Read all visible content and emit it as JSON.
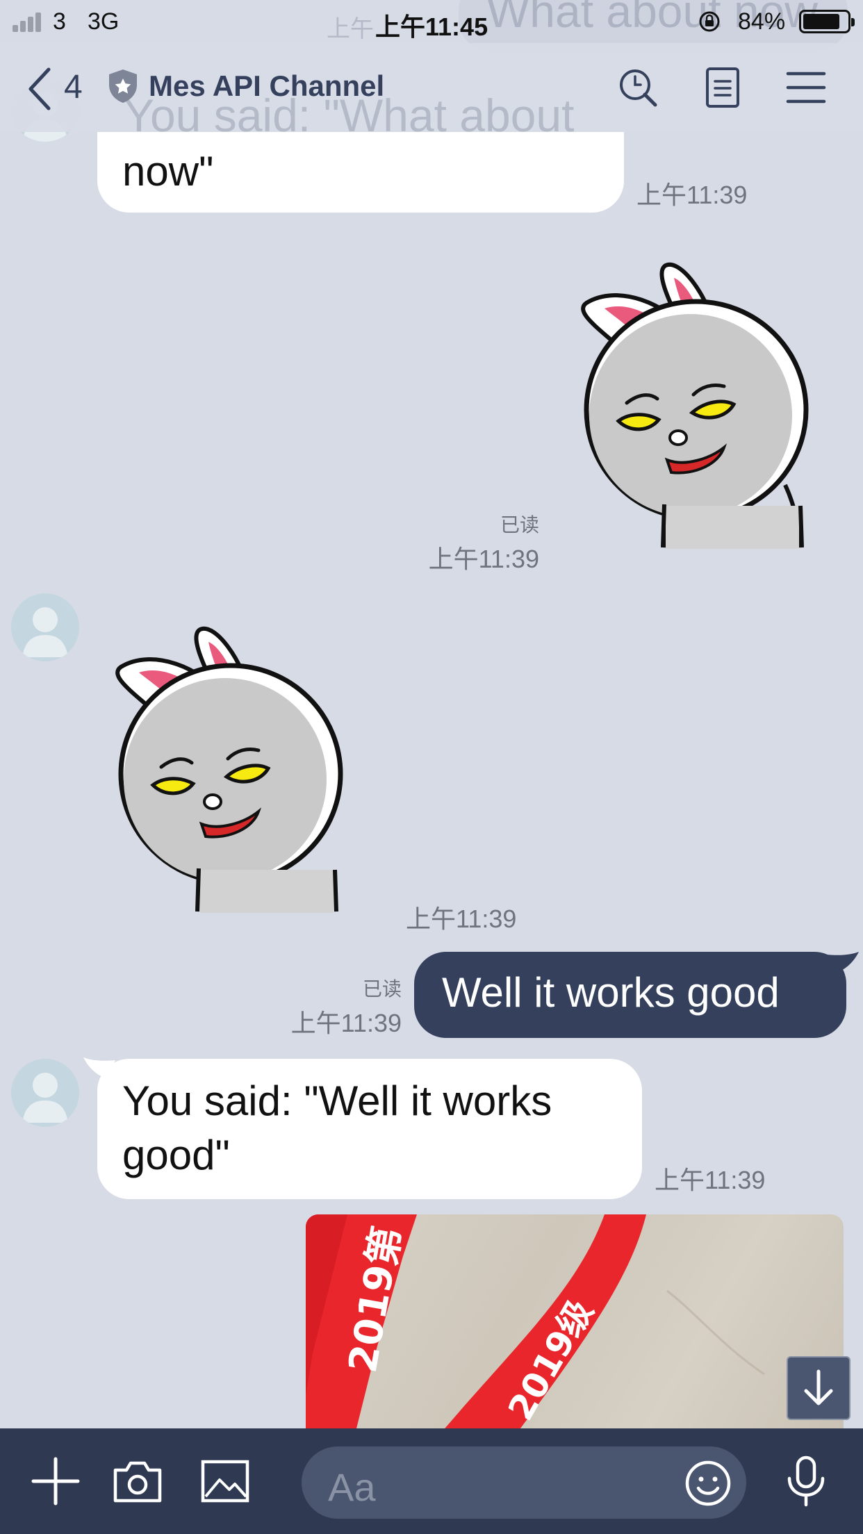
{
  "status_bar": {
    "carrier": "3",
    "network": "3G",
    "time": "上午11:45",
    "battery": "84%"
  },
  "header": {
    "back_count": "4",
    "channel_name": "Mes API Channel",
    "ghost_top": "What about now",
    "ghost_time": "上午",
    "ghost_bubble": "You said: \"What about"
  },
  "messages": [
    {
      "id": "m1",
      "side": "left",
      "type": "text",
      "text": "now\"",
      "time": "上午11:39"
    },
    {
      "id": "m2",
      "side": "right",
      "type": "sticker",
      "sticker": "bunny-smirk",
      "read": "已读",
      "time": "上午11:39"
    },
    {
      "id": "m3",
      "side": "left",
      "type": "sticker",
      "sticker": "bunny-smirk",
      "time": "上午11:39"
    },
    {
      "id": "m4",
      "side": "right",
      "type": "text",
      "text": "Well it works good",
      "read": "已读",
      "time": "上午11:39"
    },
    {
      "id": "m5",
      "side": "left",
      "type": "text",
      "text": "You said: \"Well it works good\"",
      "time": "上午11:39"
    },
    {
      "id": "m6",
      "side": "right",
      "type": "image",
      "caption": "lanyard photo",
      "lanyard_text": "2019第",
      "lanyard_text_2": "2019级"
    }
  ],
  "input_bar": {
    "placeholder": "Aa"
  },
  "icons": {
    "header": [
      "back-icon",
      "shield-icon",
      "search-icon",
      "notes-icon",
      "menu-icon"
    ],
    "input": [
      "plus-icon",
      "camera-icon",
      "image-icon",
      "emoji-icon",
      "microphone-icon"
    ]
  },
  "colors": {
    "background": "#d7dbe6",
    "accent": "#34405c",
    "own_bubble": "#34405c",
    "other_bubble": "#ffffff",
    "input_bar": "#2f3a52"
  }
}
